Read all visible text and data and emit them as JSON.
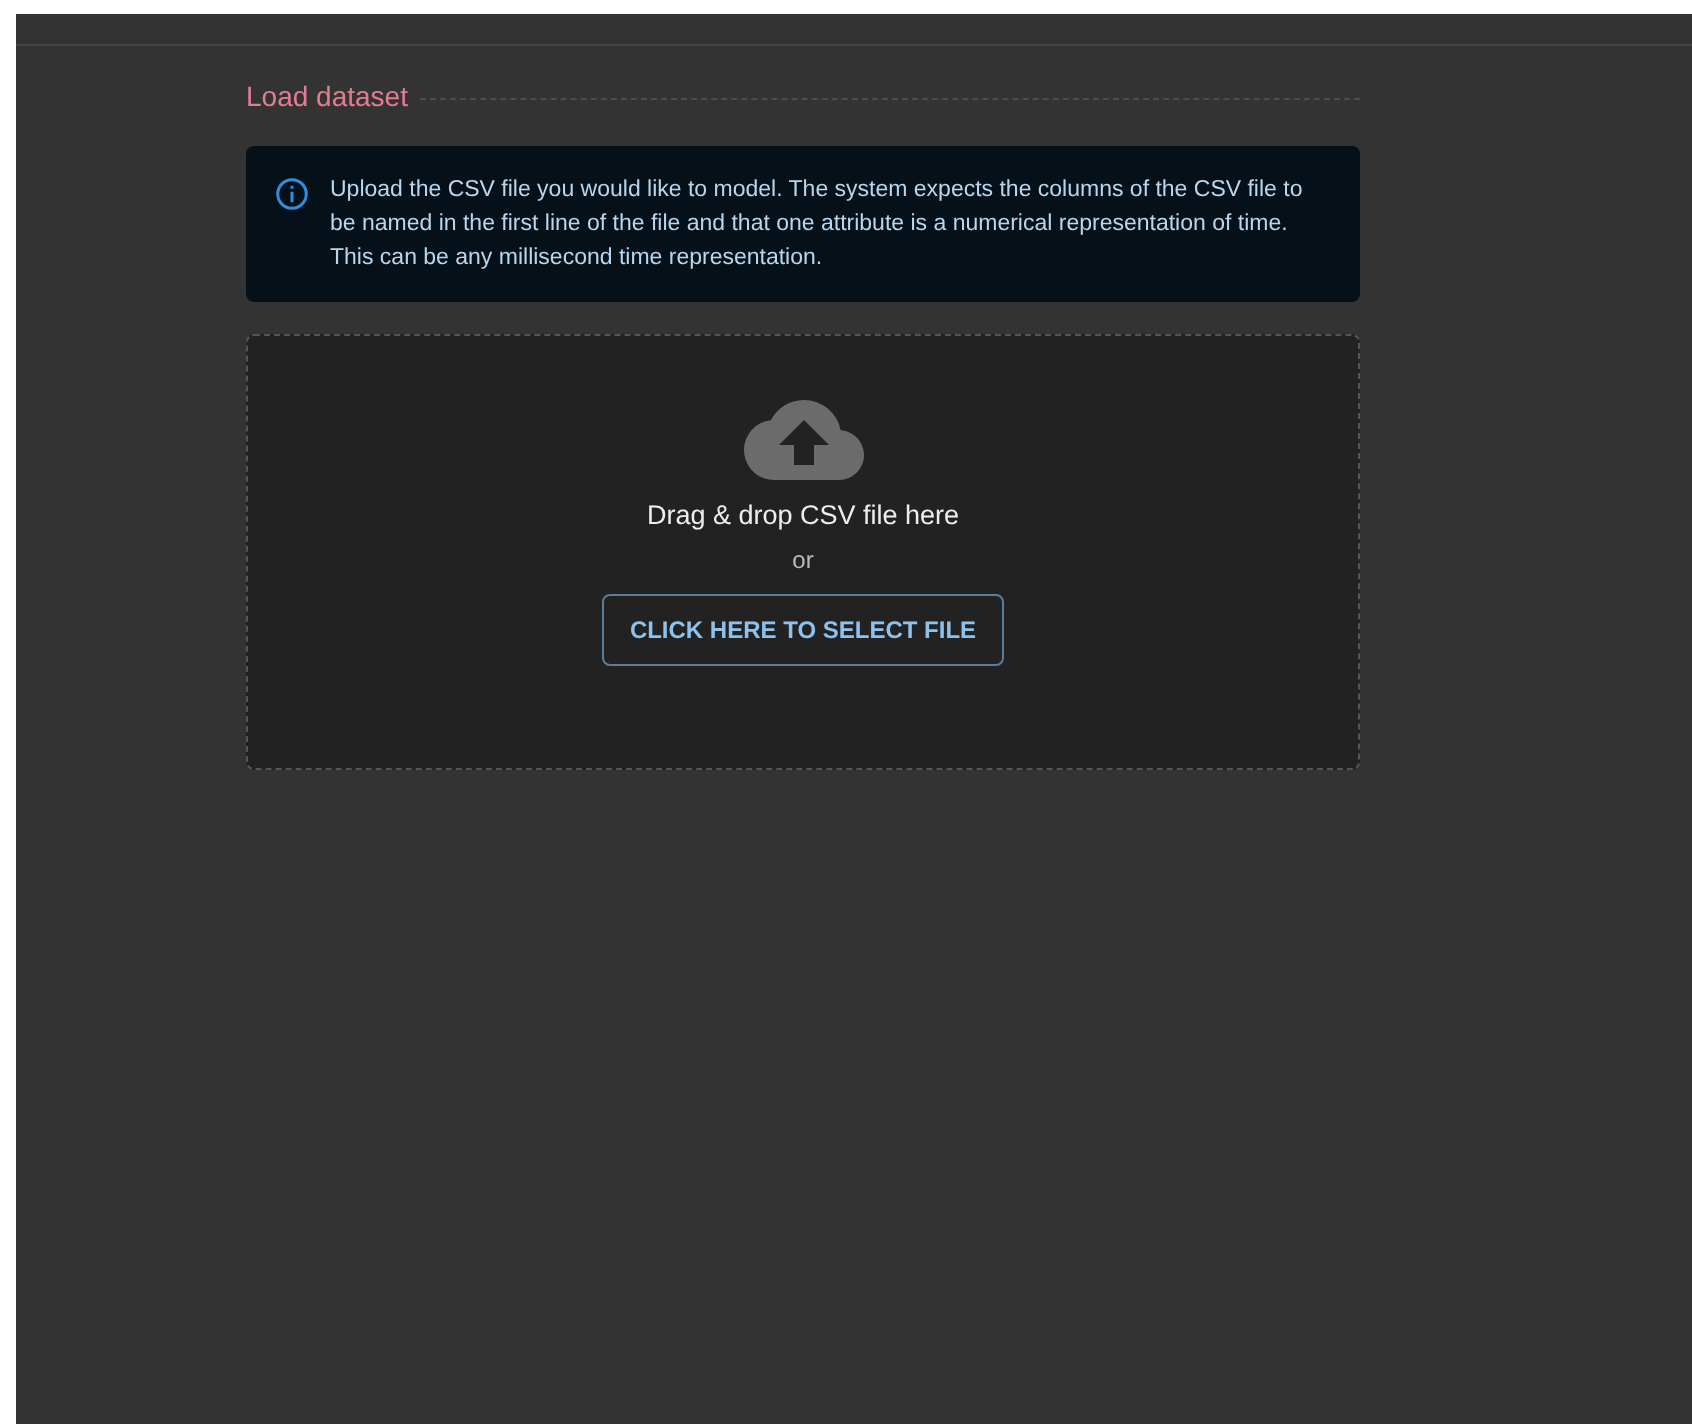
{
  "section": {
    "title": "Load dataset"
  },
  "info": {
    "text": "Upload the CSV file you would like to model. The system expects the columns of the CSV file to be named in the first line of the file and that one attribute is a numerical representation of time. This can be any millisecond time representation."
  },
  "dropzone": {
    "prompt": "Drag & drop CSV file here",
    "separator": "or",
    "button": "CLICK HERE TO SELECT FILE"
  }
}
